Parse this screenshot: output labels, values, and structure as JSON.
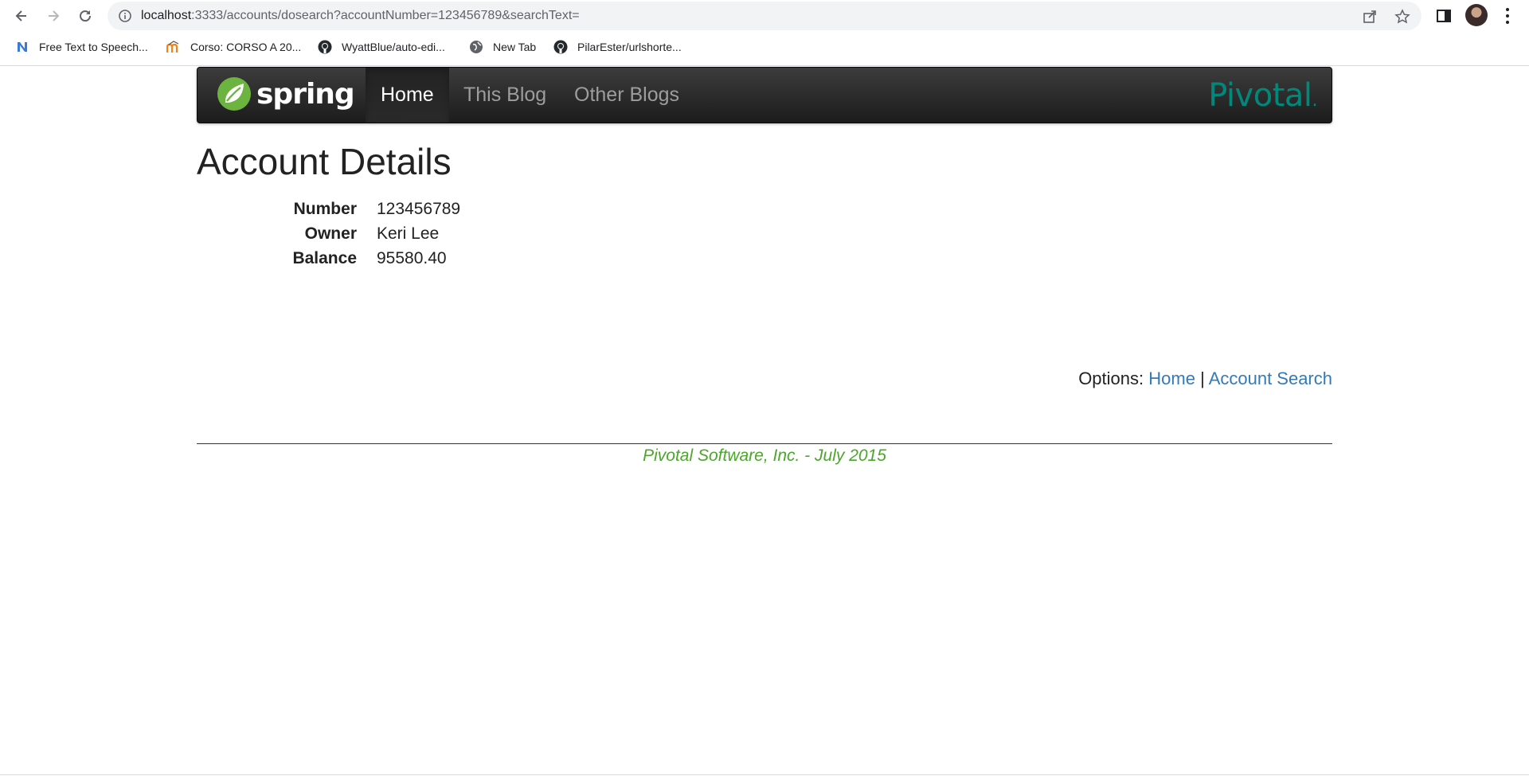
{
  "browser": {
    "url_host": "localhost",
    "url_rest": ":3333/accounts/dosearch?accountNumber=123456789&searchText=",
    "bookmarks": [
      {
        "label": "Free Text to Speech...",
        "icon": "n-letter-icon"
      },
      {
        "label": "Corso: CORSO A 20...",
        "icon": "moodle-icon"
      },
      {
        "label": "WyattBlue/auto-edi...",
        "icon": "github-icon"
      },
      {
        "label": "New Tab",
        "icon": "globe-icon"
      },
      {
        "label": "PilarEster/urlshorte...",
        "icon": "github-icon"
      }
    ]
  },
  "navbar": {
    "brand": "spring",
    "items": [
      {
        "label": "Home",
        "active": true
      },
      {
        "label": "This Blog",
        "active": false
      },
      {
        "label": "Other Blogs",
        "active": false
      }
    ],
    "partner_logo": "Pivotal",
    "partner_logo_dot": "."
  },
  "main": {
    "title": "Account Details",
    "fields": [
      {
        "label": "Number",
        "value": "123456789"
      },
      {
        "label": "Owner",
        "value": "Keri Lee"
      },
      {
        "label": "Balance",
        "value": "95580.40"
      }
    ],
    "options_label": "Options:",
    "options_links": [
      {
        "label": "Home"
      },
      {
        "label": "Account Search"
      }
    ],
    "options_separator": "|"
  },
  "footer": {
    "text": "Pivotal Software, Inc. - July 2015"
  },
  "colors": {
    "link": "#337ab7",
    "footer": "#4aa72a",
    "pivotal": "#00887b",
    "spring_leaf": "#6db33f"
  }
}
